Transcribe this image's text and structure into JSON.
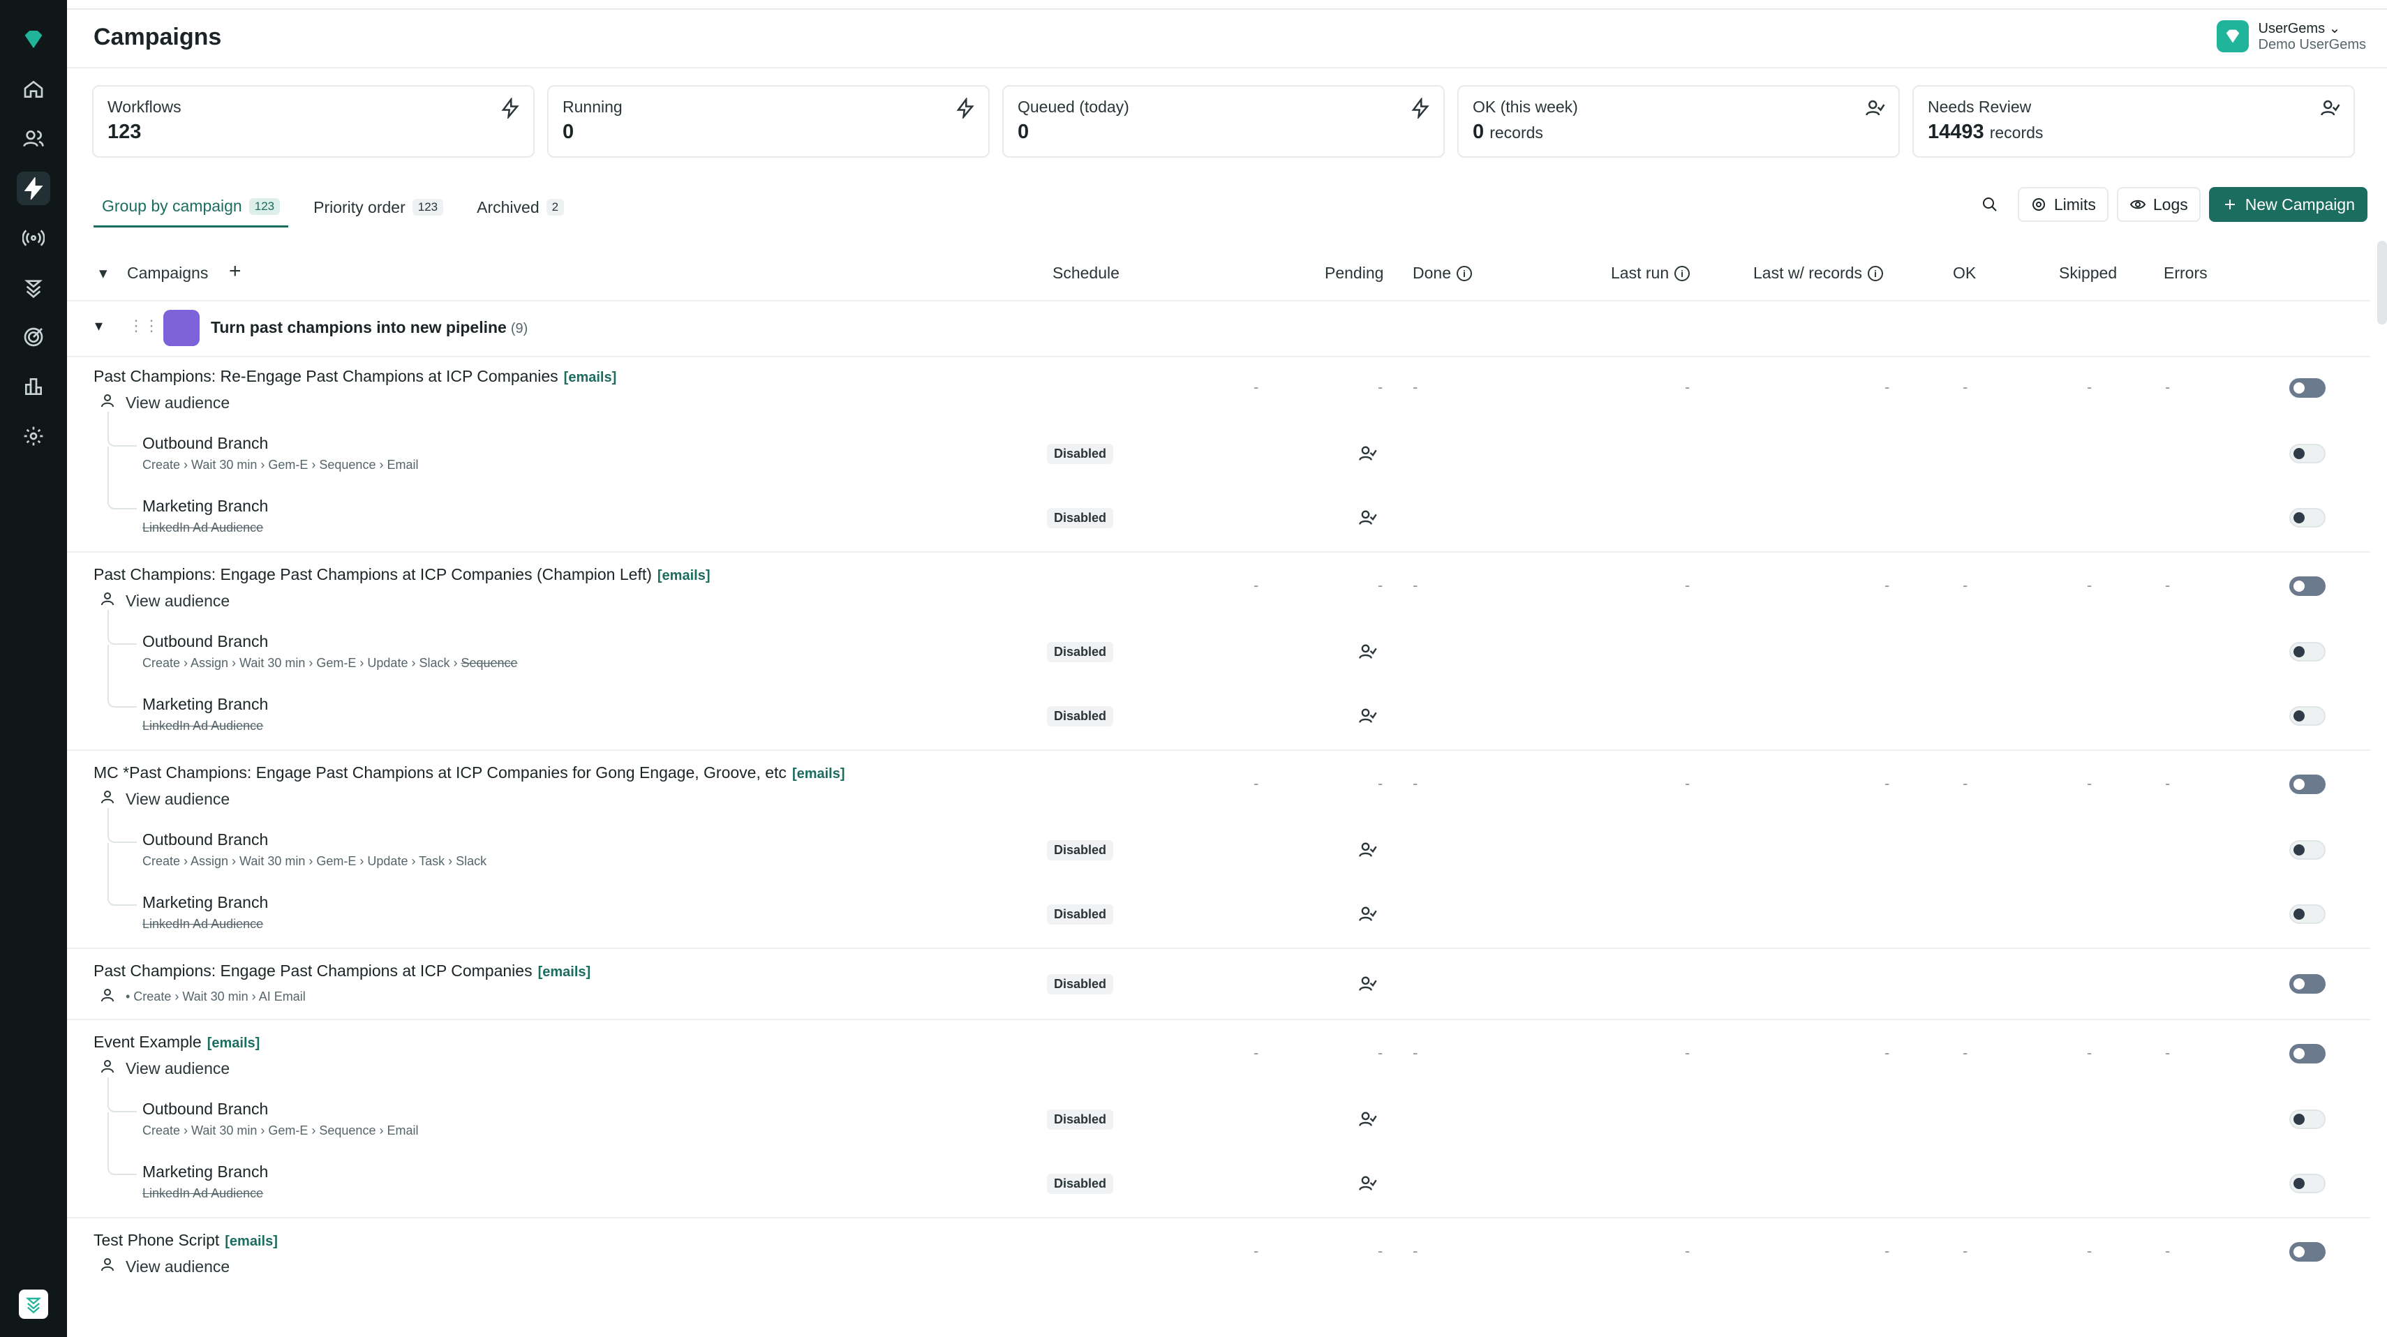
{
  "page": {
    "title": "Campaigns"
  },
  "user": {
    "name": "UserGems",
    "org": "Demo UserGems"
  },
  "stats": [
    {
      "label": "Workflows",
      "value": "123",
      "unit": "",
      "icon": "bolt-icon"
    },
    {
      "label": "Running",
      "value": "0",
      "unit": "",
      "icon": "bolt-icon"
    },
    {
      "label": "Queued (today)",
      "value": "0",
      "unit": "",
      "icon": "bolt-icon"
    },
    {
      "label": "OK (this week)",
      "value": "0",
      "unit": "records",
      "icon": "person-check-icon"
    },
    {
      "label": "Needs Review",
      "value": "14493",
      "unit": "records",
      "icon": "person-check-icon"
    }
  ],
  "tabs": [
    {
      "label": "Group by campaign",
      "count": "123"
    },
    {
      "label": "Priority order",
      "count": "123"
    },
    {
      "label": "Archived",
      "count": "2"
    }
  ],
  "toolbar": {
    "limits": "Limits",
    "logs": "Logs",
    "new_campaign": "New Campaign"
  },
  "columns": {
    "campaigns": "Campaigns",
    "schedule": "Schedule",
    "pending": "Pending",
    "done": "Done",
    "last_run": "Last run",
    "last_records": "Last w/ records",
    "ok": "OK",
    "skipped": "Skipped",
    "errors": "Errors"
  },
  "group": {
    "title": "Turn past champions into new pipeline",
    "count": "(9)"
  },
  "campaigns": [
    {
      "title": "Past Champions: Re-Engage Past Champions at ICP Companies",
      "tag": "[emails]",
      "sub": "View audience",
      "branches": [
        {
          "title": "Outbound Branch",
          "steps": "Create › Wait 30 min › Gem-E › Sequence › Email",
          "status": "Disabled"
        },
        {
          "title": "Marketing Branch",
          "steps": "LinkedIn Ad Audience",
          "status": "Disabled"
        }
      ]
    },
    {
      "title": "Past Champions: Engage Past Champions at ICP Companies (Champion Left)",
      "tag": "[emails]",
      "sub": "View audience",
      "branches": [
        {
          "title": "Outbound Branch",
          "steps": "Create › Assign › Wait 30 min › Gem-E › Update › Slack › ",
          "steps_strike": "Sequence",
          "status": "Disabled"
        },
        {
          "title": "Marketing Branch",
          "steps": "LinkedIn Ad Audience",
          "status": "Disabled"
        }
      ]
    },
    {
      "title": "MC *Past Champions: Engage Past Champions at ICP Companies for Gong Engage, Groove, etc",
      "tag": "[emails]",
      "sub": "View audience",
      "branches": [
        {
          "title": "Outbound Branch",
          "steps": "Create › Assign › Wait 30 min › Gem-E › Update › Task › Slack",
          "status": "Disabled"
        },
        {
          "title": "Marketing Branch",
          "steps": "LinkedIn Ad Audience",
          "status": "Disabled"
        }
      ]
    },
    {
      "title": "Past Champions: Engage Past Champions at ICP Companies",
      "tag": "[emails]",
      "sub": "• Create › Wait 30 min › AI Email",
      "status": "Disabled"
    },
    {
      "title": "Event Example",
      "tag": "[emails]",
      "sub": "View audience",
      "branches": [
        {
          "title": "Outbound Branch",
          "steps": "Create › Wait 30 min › Gem-E › Sequence › Email",
          "status": "Disabled"
        },
        {
          "title": "Marketing Branch",
          "steps": "LinkedIn Ad Audience",
          "status": "Disabled"
        }
      ]
    },
    {
      "title": "Test Phone Script",
      "tag": "[emails]",
      "sub": "View audience"
    }
  ],
  "dash": "-"
}
